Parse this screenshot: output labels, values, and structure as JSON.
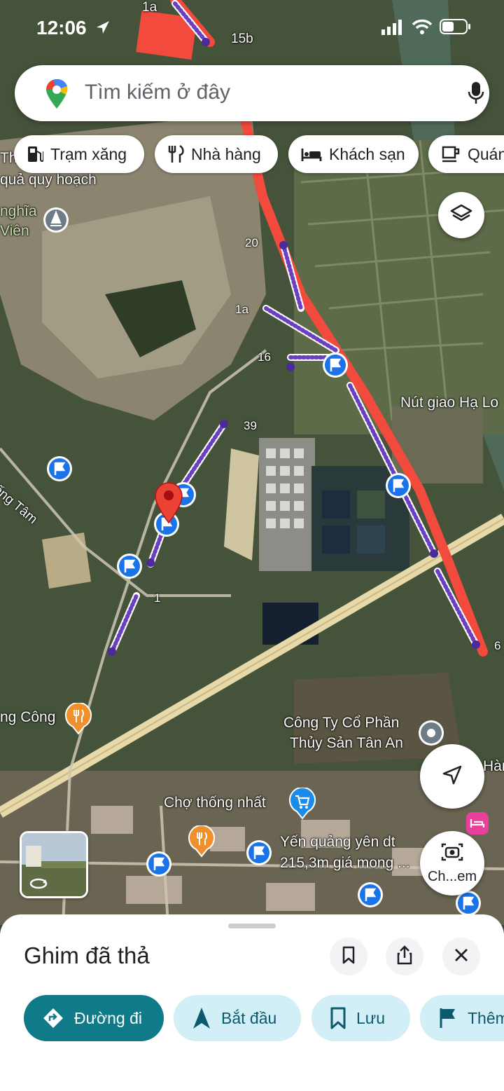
{
  "status_bar": {
    "time": "12:06"
  },
  "search": {
    "placeholder": "Tìm kiếm ở đây"
  },
  "chips": [
    {
      "label": "Trạm xăng",
      "icon": "gas-station-icon"
    },
    {
      "label": "Nhà hàng",
      "icon": "restaurant-icon"
    },
    {
      "label": "Khách sạn",
      "icon": "hotel-icon"
    },
    {
      "label": "Quán",
      "icon": "coffee-icon"
    }
  ],
  "map": {
    "place_labels": [
      "1a",
      "15b",
      "Thu",
      "quả quy hoạch",
      "nghĩa",
      "Viên",
      "Nút giao Hạ Lo",
      "ống Tâm",
      "ng Công",
      "Công Ty Cổ Phần",
      "Thủy Sản Tân An",
      "Chợ thống nhất",
      "Hàn",
      "Yến quảng yên dt",
      "215,3m giá mong ..."
    ],
    "road_labels": [
      "20",
      "1a",
      "16",
      "39",
      "1",
      "6"
    ],
    "pin_label": "dropped-pin",
    "colors": {
      "route_red": "#f24a3c",
      "marker_blue": "#1a73e8",
      "marker_purple": "#5b3fae",
      "highway": "#e8d9a8",
      "pin_red": "#ea4335"
    }
  },
  "camera_button": {
    "label": "Ch...em"
  },
  "sheet": {
    "title": "Ghim đã thả",
    "actions": [
      {
        "label": "Đường đi",
        "icon": "directions-icon"
      },
      {
        "label": "Bắt đầu",
        "icon": "navigation-arrow-icon"
      },
      {
        "label": "Lưu",
        "icon": "bookmark-icon"
      },
      {
        "label": "Thêm",
        "icon": "flag-icon"
      }
    ]
  }
}
